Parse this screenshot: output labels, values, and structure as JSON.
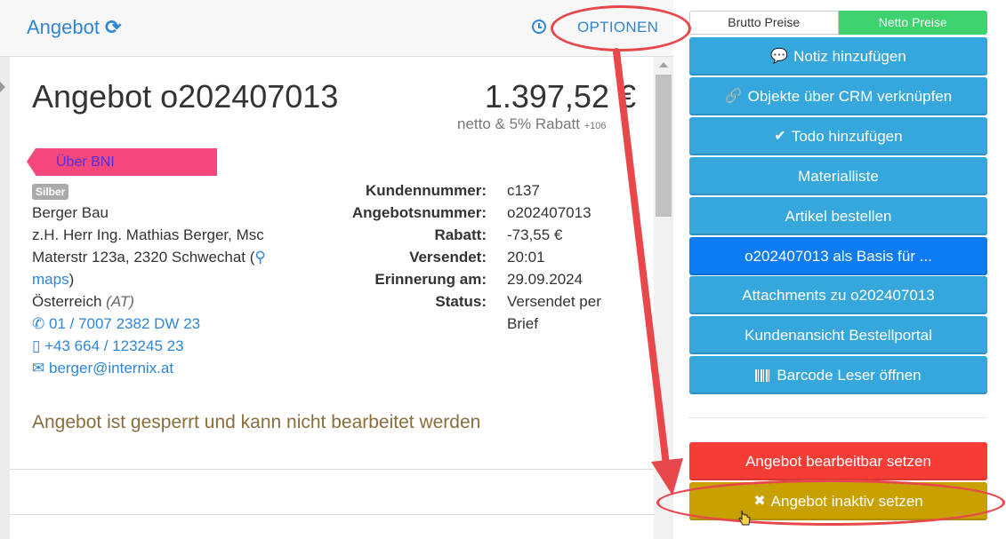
{
  "header": {
    "title": "Angebot",
    "options_label": "OPTIONEN"
  },
  "offer": {
    "title": "Angebot o202407013",
    "price": "1.397,52 €",
    "price_note": "netto & 5% Rabatt",
    "price_note_small": "+106",
    "tag": "Über BNI",
    "customer_level": "Silber",
    "customer": {
      "company": "Berger Bau",
      "contact": "z.H. Herr Ing. Mathias Berger, Msc",
      "street": "Materstr 123a, 2320 Schwechat (",
      "maps_label": "maps",
      "close_paren": ")",
      "country": "Österreich",
      "country_code": "(AT)",
      "phone": "01 / 7007 2382 DW 23",
      "mobile": "+43 664 / 123245 23",
      "email": "berger@internix.at"
    },
    "details": [
      {
        "label": "Kundennummer:",
        "value": "c137"
      },
      {
        "label": "Angebotsnummer:",
        "value": "o202407013"
      },
      {
        "label": "Rabatt:",
        "value": "-73,55 €"
      },
      {
        "label": "Versendet:",
        "value": "20:01"
      },
      {
        "label": "Erinnerung am:",
        "value": "29.09.2024"
      },
      {
        "label": "Status:",
        "value": "Versendet per",
        "value2": "Brief"
      }
    ],
    "locked_message": "Angebot ist gesperrt und kann nicht bearbeitet werden"
  },
  "sidebar": {
    "price_toggle": {
      "brutto": "Brutto Preise",
      "netto": "Netto Preise"
    },
    "actions": [
      {
        "label": "Notiz hinzufügen",
        "icon": "comment-icon"
      },
      {
        "label": "Objekte über CRM verknüpfen",
        "icon": "link-icon"
      },
      {
        "label": "Todo hinzufügen",
        "icon": "check-icon"
      },
      {
        "label": "Materialliste",
        "icon": ""
      },
      {
        "label": "Artikel bestellen",
        "icon": ""
      },
      {
        "label": "o202407013 als Basis für ...",
        "icon": ""
      },
      {
        "label": "Attachments zu o202407013",
        "icon": ""
      },
      {
        "label": "Kundenansicht Bestellportal",
        "icon": ""
      },
      {
        "label": "Barcode Leser öffnen",
        "icon": "barcode-icon"
      }
    ],
    "danger_actions": [
      {
        "label": "Angebot bearbeitbar setzen"
      },
      {
        "label": "Angebot inaktiv setzen",
        "icon": "times-icon"
      }
    ]
  },
  "colors": {
    "link": "#2e86d4",
    "info": "#35a7dc",
    "primary": "#0d7cf2",
    "danger": "#f53d36",
    "warning": "#c8a000",
    "success": "#3ed36f",
    "tag": "#f4477e",
    "annotation": "#e8484b"
  }
}
